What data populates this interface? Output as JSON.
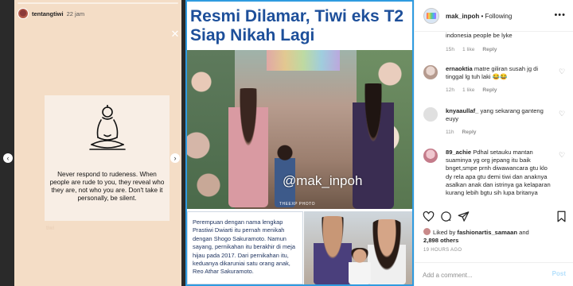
{
  "story": {
    "username": "tentangtiwi",
    "time": "22 jam",
    "quote": "Never respond to rudeness. When people are rude to you, they reveal who they are, not who you are. Don't take it personally, be silent.",
    "handle": "tiwi"
  },
  "post_image": {
    "headline": "Resmi Dilamar, Tiwi eks T2 Siap Nikah Lagi",
    "watermark": "@mak_inpoh",
    "credit": "THEEXP PHOTO",
    "caption": "Perempuan dengan nama lengkap Prastiwi Dwiarti itu pernah menikah dengan Shogo Sakuramoto. Namun sayang, pernikahan itu berakhir di meja hijau pada 2017. Dari pernikahan itu, keduanya dikaruniai satu orang anak, Reo Athar Sakuramoto."
  },
  "header": {
    "username": "mak_inpoh",
    "follow_status": "• Following",
    "more": "•••"
  },
  "comments": [
    {
      "username": "",
      "text": "indonesia people be lyke",
      "time": "15h",
      "likes": "1 like",
      "reply": "Reply"
    },
    {
      "username": "ernaoktia",
      "text": "matre giliran susah jg di tinggal lg tuh laki 😂😂",
      "time": "12h",
      "likes": "1 like",
      "reply": "Reply"
    },
    {
      "username": "knyaaullaf_",
      "text": "yang sekarang ganteng euyy",
      "time": "11h",
      "likes": "",
      "reply": "Reply"
    },
    {
      "username": "89_achie",
      "text": "Pdhal setauku mantan suaminya yg org jepang itu baik bnget,smpe prnh diwawancara gtu klo dy rela apa gtu demi tiwi dan anaknya asalkan anak dan istrinya ga kelaparan kurang lebih bgtu sih lupa britanya",
      "time": "",
      "likes": "",
      "reply": ""
    }
  ],
  "actions": {
    "like_icon": "heart-icon",
    "comment_icon": "comment-icon",
    "share_icon": "share-icon",
    "save_icon": "bookmark-icon"
  },
  "likes": {
    "liked_by_prefix": "Liked by",
    "liked_by_user": "fashionartis_samaan",
    "and": "and",
    "count": "2,898 others"
  },
  "post_time": "19 HOURS AGO",
  "add_comment": {
    "placeholder": "Add a comment...",
    "post_label": "Post"
  }
}
